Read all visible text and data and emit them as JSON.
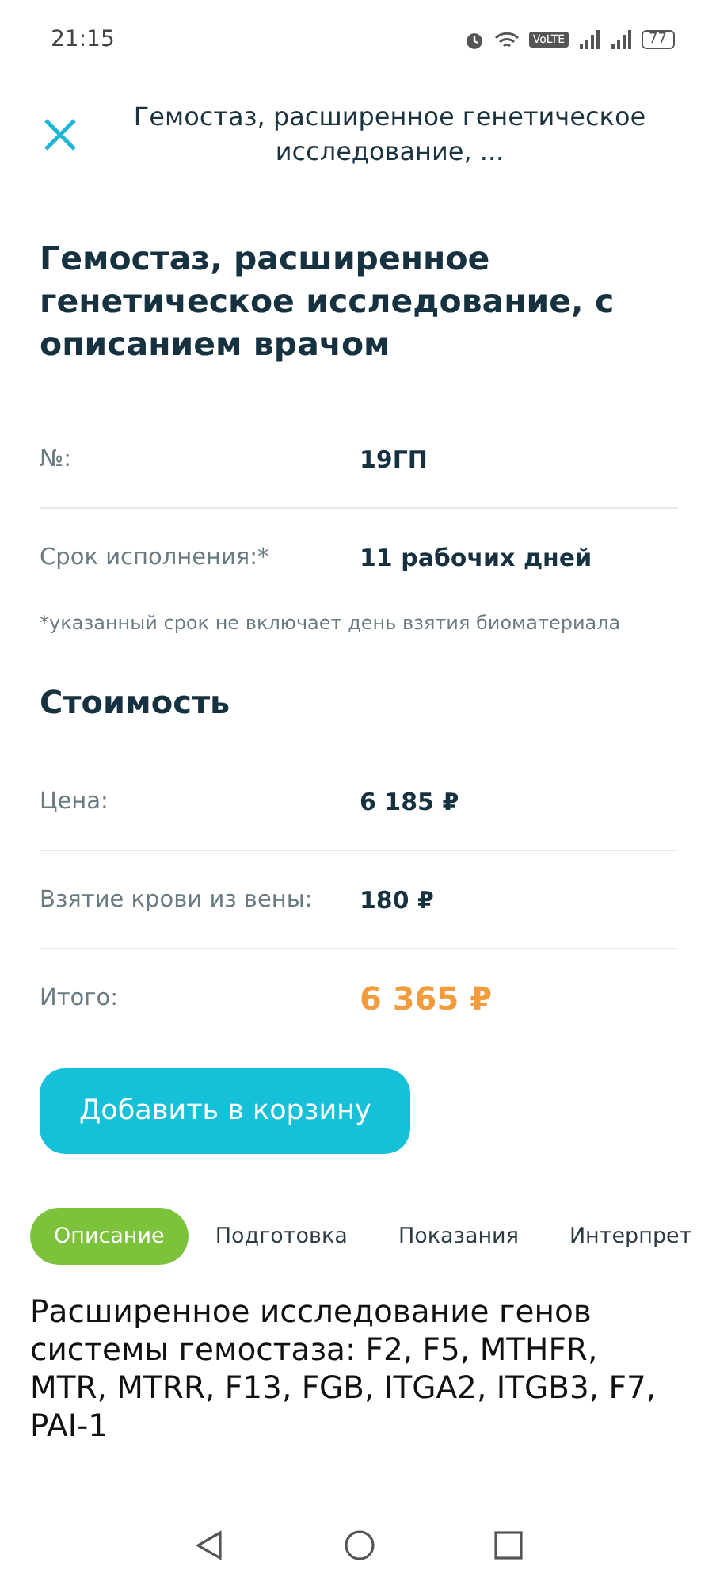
{
  "status_bar": {
    "time": "21:15",
    "volte": "VoLTE",
    "battery": "77"
  },
  "header": {
    "title": "Гемостаз, расширенное генетическое исследование, ..."
  },
  "title": "Гемостаз, расширенное генетическое исследование, с описанием врачом",
  "details": [
    {
      "label": "№:",
      "value": "19ГП"
    },
    {
      "label": "Срок исполнения:*",
      "value": "11 рабочих дней"
    }
  ],
  "footnote": "*указанный срок не включает день взятия биоматериала",
  "cost": {
    "heading": "Стоимость",
    "rows": [
      {
        "kind": "price",
        "label": "Цена:",
        "value": "6 185 ₽"
      },
      {
        "kind": "price",
        "label": "Взятие крови из вены:",
        "value": "180 ₽"
      },
      {
        "kind": "total",
        "label": "Итого:",
        "value": "6 365 ₽"
      }
    ]
  },
  "add_button": "Добавить в корзину",
  "tabs": [
    {
      "label": "Описание",
      "selected": true
    },
    {
      "label": "Подготовка",
      "selected": false
    },
    {
      "label": "Показания",
      "selected": false
    },
    {
      "label": "Интерпрет",
      "selected": false
    }
  ],
  "description": "Расширенное исследование генов системы гемостаза: F2, F5, MTHFR, MTR, MTRR, F13, FGB, ITGA2, ITGB3, F7, PAI-1"
}
